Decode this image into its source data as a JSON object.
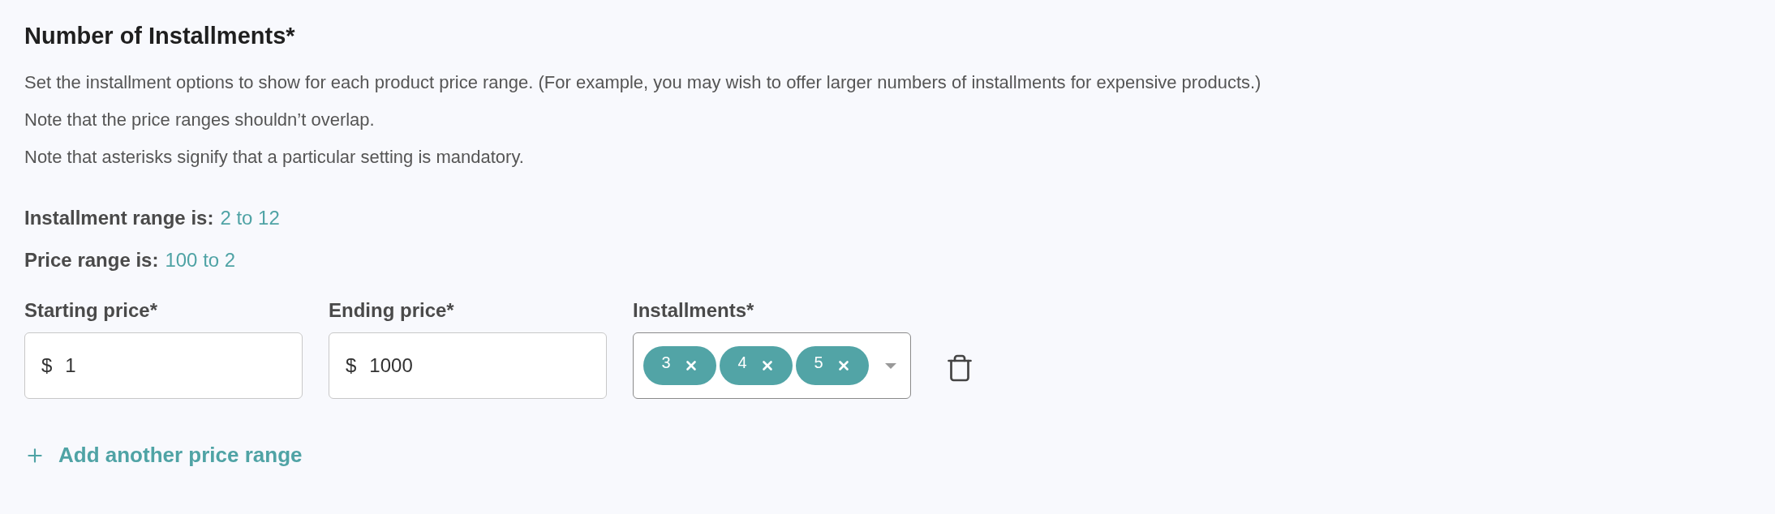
{
  "title": "Number of Installments*",
  "description": [
    "Set the installment options to show for each product price range. (For example, you may wish to offer larger numbers of installments for expensive products.)",
    "Note that the price ranges shouldn’t overlap.",
    "Note that asterisks signify that a particular setting is mandatory."
  ],
  "ranges": [
    {
      "label": "Installment range is:",
      "value": "2 to 12"
    },
    {
      "label": "Price range is:",
      "value": "100 to 2"
    }
  ],
  "price_rows": [
    {
      "starting_label": "Starting price*",
      "starting_currency": "$",
      "starting_value": "1",
      "ending_label": "Ending price*",
      "ending_currency": "$",
      "ending_value": "1000",
      "installments_label": "Installments*",
      "installments": [
        "3",
        "4",
        "5"
      ]
    }
  ],
  "add_button": {
    "label": "Add another price range"
  }
}
